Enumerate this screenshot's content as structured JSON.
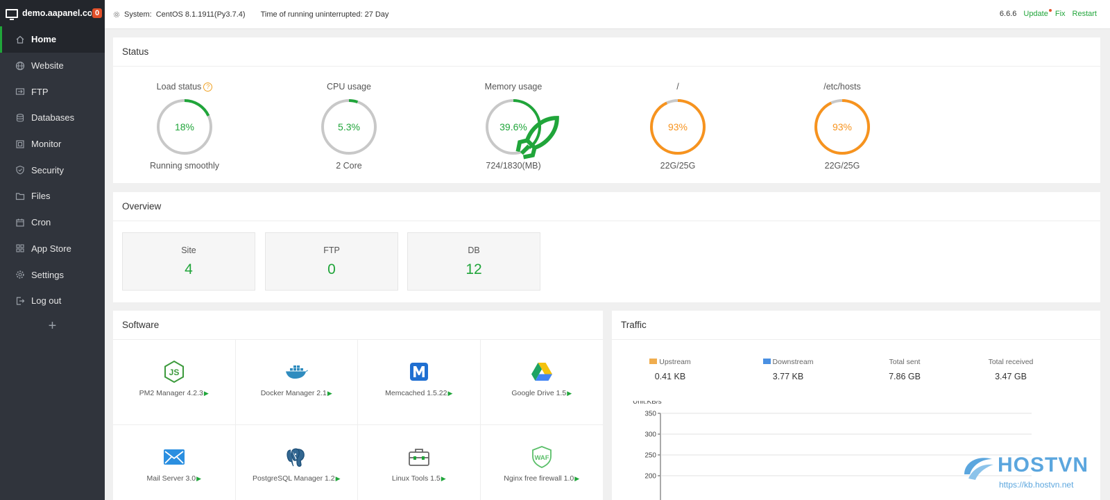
{
  "sidebar": {
    "brand": "demo.aapanel.com",
    "badge": "0",
    "items": [
      {
        "label": "Home",
        "icon": "home-icon"
      },
      {
        "label": "Website",
        "icon": "globe-icon"
      },
      {
        "label": "FTP",
        "icon": "ftp-icon"
      },
      {
        "label": "Databases",
        "icon": "database-icon"
      },
      {
        "label": "Monitor",
        "icon": "monitor-icon"
      },
      {
        "label": "Security",
        "icon": "shield-icon"
      },
      {
        "label": "Files",
        "icon": "folder-icon"
      },
      {
        "label": "Cron",
        "icon": "calendar-icon"
      },
      {
        "label": "App Store",
        "icon": "grid-icon"
      },
      {
        "label": "Settings",
        "icon": "gear-icon"
      },
      {
        "label": "Log out",
        "icon": "logout-icon"
      }
    ],
    "add": "+"
  },
  "topbar": {
    "system_label": "System:",
    "system_value": "CentOS 8.1.1911(Py3.7.4)",
    "uptime": "Time of running uninterrupted: 27 Day",
    "version": "6.6.6",
    "update": "Update",
    "fix": "Fix",
    "restart": "Restart"
  },
  "status": {
    "title": "Status",
    "gauges": [
      {
        "label": "Load status",
        "value": "18%",
        "percent": 18,
        "sub": "Running smoothly",
        "color": "#20a53a"
      },
      {
        "label": "CPU usage",
        "value": "5.3%",
        "percent": 5.3,
        "sub": "2 Core",
        "color": "#20a53a"
      },
      {
        "label": "Memory usage",
        "value": "39.6%",
        "percent": 39.6,
        "sub": "724/1830(MB)",
        "color": "#20a53a"
      },
      {
        "label": "/",
        "value": "93%",
        "percent": 93,
        "sub": "22G/25G",
        "color": "#f7931e"
      },
      {
        "label": "/etc/hosts",
        "value": "93%",
        "percent": 93,
        "sub": "22G/25G",
        "color": "#f7931e"
      }
    ]
  },
  "overview": {
    "title": "Overview",
    "cards": [
      {
        "label": "Site",
        "value": "4"
      },
      {
        "label": "FTP",
        "value": "0"
      },
      {
        "label": "DB",
        "value": "12"
      }
    ]
  },
  "software": {
    "title": "Software",
    "items": [
      {
        "name": "PM2 Manager 4.2.3",
        "icon": "nodejs-icon"
      },
      {
        "name": "Docker Manager 2.1",
        "icon": "docker-icon"
      },
      {
        "name": "Memcached 1.5.22",
        "icon": "memcached-icon"
      },
      {
        "name": "Google Drive 1.5",
        "icon": "google-drive-icon"
      },
      {
        "name": "Mail Server 3.0",
        "icon": "mail-icon"
      },
      {
        "name": "PostgreSQL Manager 1.2",
        "icon": "postgresql-icon"
      },
      {
        "name": "Linux Tools 1.5",
        "icon": "toolbox-icon"
      },
      {
        "name": "Nginx free firewall 1.0",
        "icon": "waf-icon"
      }
    ]
  },
  "traffic": {
    "title": "Traffic",
    "stats": [
      {
        "label": "Upstream",
        "value": "0.41 KB",
        "color": "#f0ad4e"
      },
      {
        "label": "Downstream",
        "value": "3.77 KB",
        "color": "#4a90e2"
      },
      {
        "label": "Total sent",
        "value": "7.86 GB"
      },
      {
        "label": "Total received",
        "value": "3.47 GB"
      }
    ]
  },
  "chart_data": {
    "type": "line",
    "ylabel": "Unit:KB/s",
    "yticks": [
      350,
      300,
      250,
      200
    ],
    "ylim": [
      200,
      350
    ],
    "series": []
  },
  "watermark": {
    "logo": "HOSTVN",
    "url": "https://kb.hostvn.net"
  }
}
